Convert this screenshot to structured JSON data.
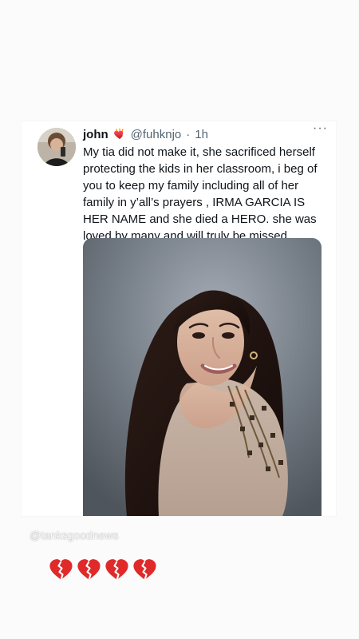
{
  "tweet": {
    "display_name": "john",
    "handle": "@fuhknjo",
    "separator": "·",
    "time": "1h",
    "more_label": "···",
    "text": "My tia did not make it, she sacrificed herself protecting the kids in her classroom, i beg of you to keep my family including all of her family in y’all’s prayers , IRMA GARCIA IS HER NAME and she died a HERO. she was loved by many and will truly be missed.",
    "badge_icon": "heart-icon"
  },
  "story": {
    "watermark": "@tanksgoodnews",
    "hearts": [
      "broken-heart-icon",
      "broken-heart-icon",
      "broken-heart-icon",
      "broken-heart-icon"
    ]
  },
  "colors": {
    "background": "#ffffff",
    "text": "#0f1419",
    "muted": "#536471",
    "heart": "#e02a2a"
  }
}
